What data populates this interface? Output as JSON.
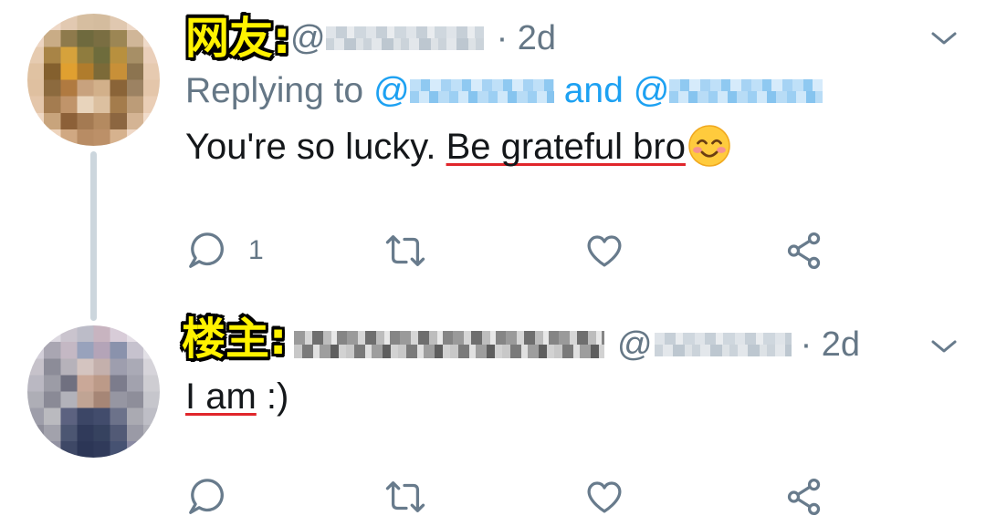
{
  "colors": {
    "text": "#14171a",
    "secondary": "#657786",
    "link": "#1da1f2",
    "icon": "#687b8c",
    "thread-line": "#ccd6dd",
    "label-fill": "#fff200",
    "label-outline": "#000000",
    "annotation": "#e0262b"
  },
  "tweets": [
    {
      "overlay_label": "网友:",
      "handle_at": "@",
      "timestamp": "· 2d",
      "menu_icon": "chevron-down-icon",
      "reply_context": {
        "prefix": "Replying to",
        "mention_1_at": "@",
        "conjunction": "and",
        "mention_2_at": "@"
      },
      "body": {
        "text": "You're so lucky.",
        "underlined_text": "Be grateful bro",
        "emoji": "smiling-face-with-smiling-eyes"
      },
      "actions": {
        "reply_icon": "reply-icon",
        "reply_count": "1",
        "retweet_icon": "retweet-icon",
        "like_icon": "heart-icon",
        "share_icon": "share-icon"
      }
    },
    {
      "overlay_label": "楼主:",
      "handle_at": "@",
      "timestamp": "· 2d",
      "menu_icon": "chevron-down-icon",
      "body": {
        "underlined_text": "I am",
        "text": ":)"
      },
      "actions": {
        "reply_icon": "reply-icon",
        "retweet_icon": "retweet-icon",
        "like_icon": "heart-icon",
        "share_icon": "share-icon"
      }
    }
  ]
}
